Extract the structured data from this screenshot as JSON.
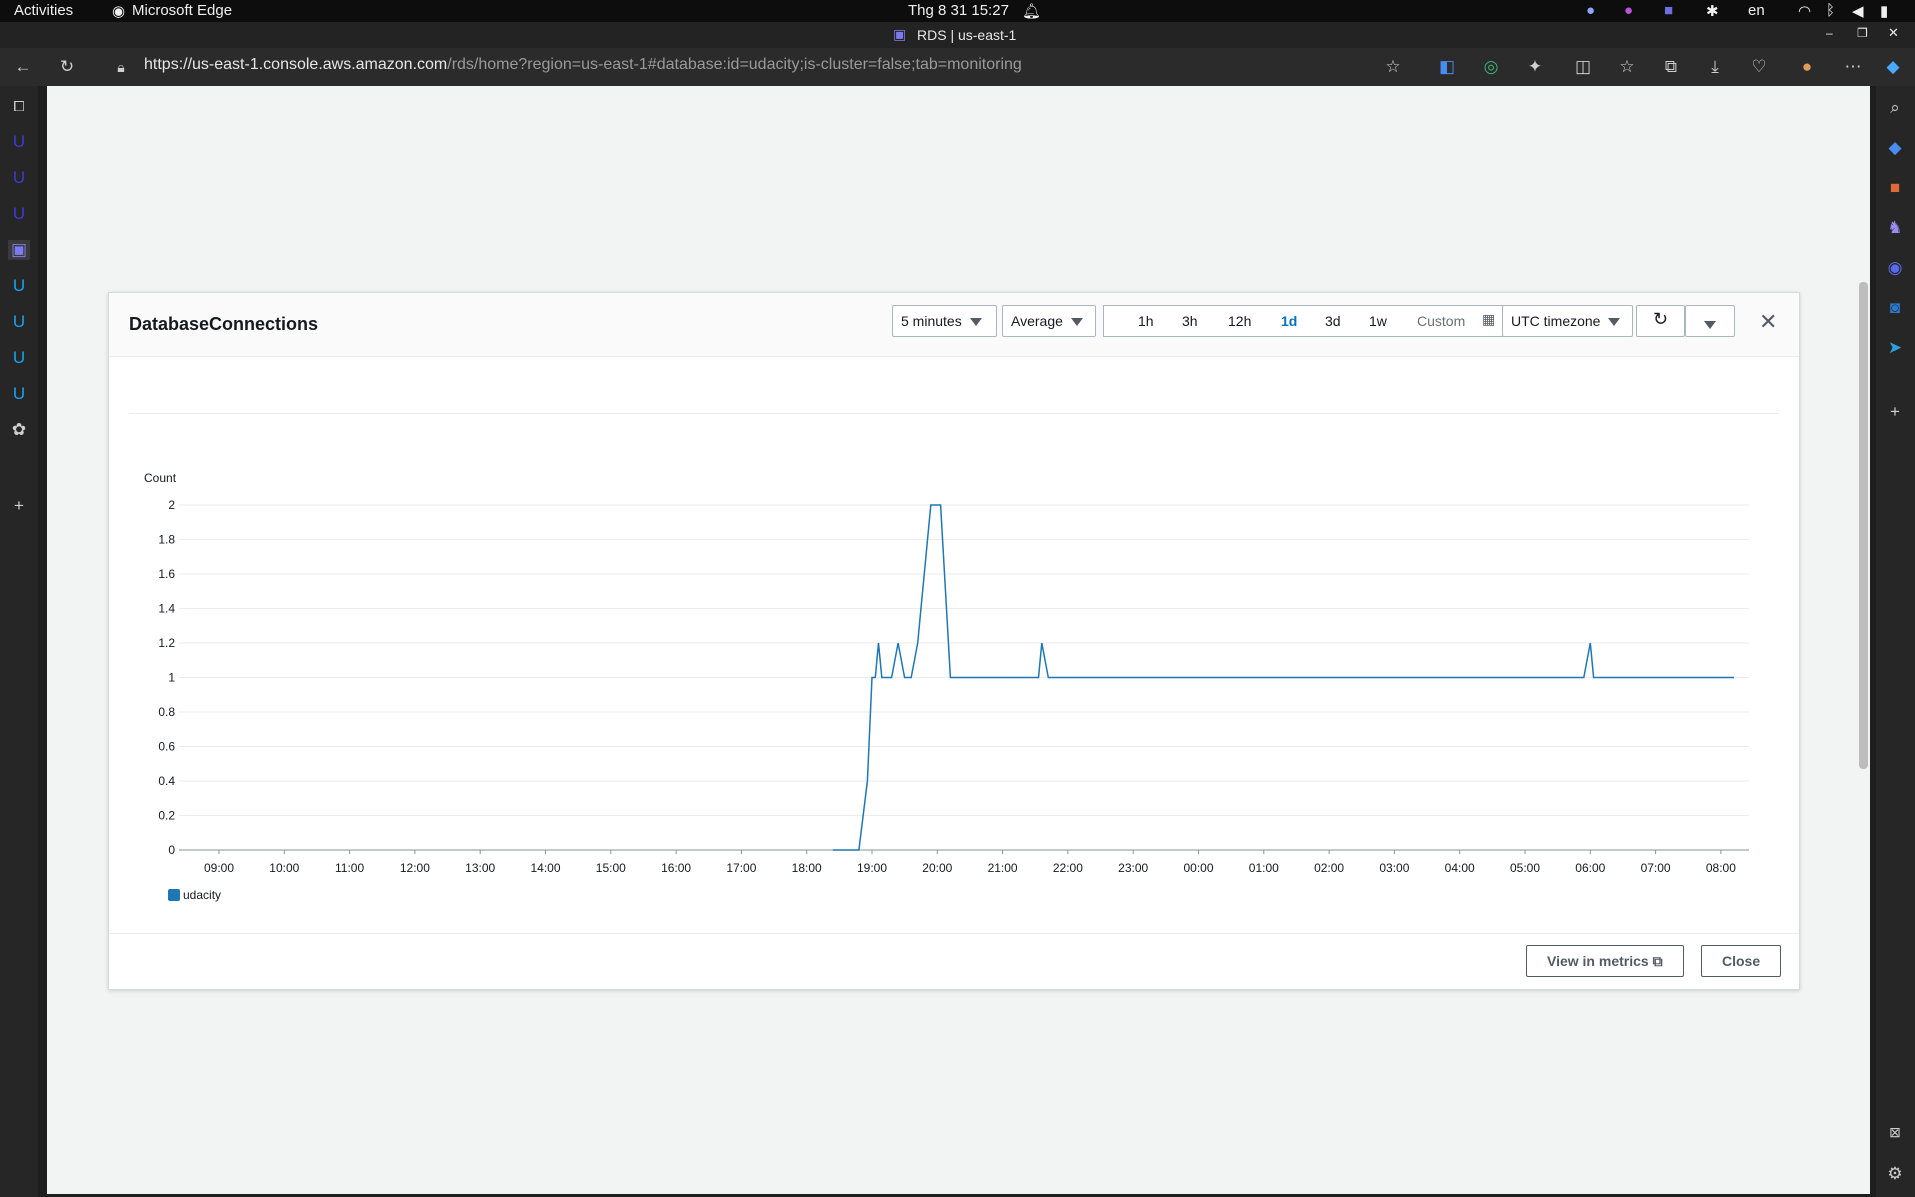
{
  "os_topbar": {
    "activities": "Activities",
    "app_name": "Microsoft Edge",
    "datetime": "Thg 8 31  15:27",
    "language": "en"
  },
  "window": {
    "title": "RDS | us-east-1"
  },
  "browser": {
    "url_host": "https://us-east-1.console.aws.amazon.com",
    "url_path": "/rds/home?region=us-east-1#database:id=udacity;is-cluster=false;tab=monitoring"
  },
  "modal": {
    "title": "DatabaseConnections",
    "period": "5 minutes",
    "statistic": "Average",
    "ranges": [
      "1h",
      "3h",
      "12h",
      "1d",
      "3d",
      "1w"
    ],
    "active_range": "1d",
    "custom": "Custom",
    "timezone": "UTC timezone",
    "view_in_metrics": "View in metrics",
    "close": "Close"
  },
  "chart_data": {
    "type": "line",
    "ylabel": "Count",
    "ylim": [
      0,
      2
    ],
    "yticks": [
      "0",
      "0.2",
      "0.4",
      "0.6",
      "0.8",
      "1",
      "1.2",
      "1.4",
      "1.6",
      "1.8",
      "2"
    ],
    "xticks": [
      "09:00",
      "10:00",
      "11:00",
      "12:00",
      "13:00",
      "14:00",
      "15:00",
      "16:00",
      "17:00",
      "18:00",
      "19:00",
      "20:00",
      "21:00",
      "22:00",
      "23:00",
      "00:00",
      "01:00",
      "02:00",
      "03:00",
      "04:00",
      "05:00",
      "06:00",
      "07:00",
      "08:00"
    ],
    "x_hours_from_0900": [
      9.4,
      9.8,
      9.93,
      10.0,
      10.05,
      10.1,
      10.15,
      10.3,
      10.4,
      10.5,
      10.55,
      10.6,
      10.7,
      10.9,
      11.05,
      11.2,
      11.3,
      11.35,
      11.45,
      11.55,
      11.6,
      12.55,
      12.6,
      12.7,
      20.9,
      21.0,
      21.05,
      23.2
    ],
    "values": [
      0,
      0,
      0.4,
      1,
      1,
      1.2,
      1,
      1,
      1.2,
      1,
      1,
      1,
      1.2,
      2,
      2,
      1,
      1,
      1,
      1,
      1,
      1,
      1,
      1.2,
      1,
      1,
      1.2,
      1,
      1
    ],
    "series": [
      {
        "name": "udacity",
        "color": "#1f77b4"
      }
    ],
    "grid": true,
    "legend": "bottom-left"
  }
}
